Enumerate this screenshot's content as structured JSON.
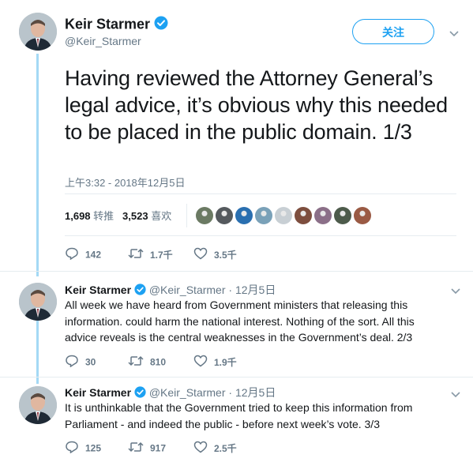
{
  "main": {
    "name": "Keir Starmer",
    "handle": "@Keir_Starmer",
    "follow_label": "关注",
    "text": "Having reviewed the Attorney General’s legal advice, it’s obvious why this needed to be placed in the public domain. 1/3",
    "timestamp": "上午3:32 - 2018年12月5日",
    "retweets_count": "1,698",
    "retweets_label": "转推",
    "likes_count": "3,523",
    "likes_label": "喜欢",
    "likers_colors": [
      "#6b7a63",
      "#555a5e",
      "#2a6fb0",
      "#7aa1b8",
      "#c8cfd4",
      "#7d4e3e",
      "#8b6f88",
      "#4d5b4b",
      "#9a5a44"
    ],
    "actions": {
      "replies": "142",
      "retweets": "1.7千",
      "likes": "3.5千"
    }
  },
  "replies": [
    {
      "name": "Keir Starmer",
      "handle": "@Keir_Starmer",
      "date": "12月5日",
      "text": "All week we have heard from Government ministers that releasing this information. could harm the national interest. Nothing of the sort. All this advice reveals is the central weaknesses in the Government’s deal. 2/3",
      "actions": {
        "replies": "30",
        "retweets": "810",
        "likes": "1.9千"
      }
    },
    {
      "name": "Keir Starmer",
      "handle": "@Keir_Starmer",
      "date": "12月5日",
      "text": "It is unthinkable that the Government tried to keep this information from Parliament - and indeed the public - before next week’s vote. 3/3",
      "actions": {
        "replies": "125",
        "retweets": "917",
        "likes": "2.5千"
      }
    }
  ],
  "separator": "·",
  "colors": {
    "accent": "#1da1f2",
    "thread_line": "#a4d9f5",
    "muted": "#657786"
  }
}
